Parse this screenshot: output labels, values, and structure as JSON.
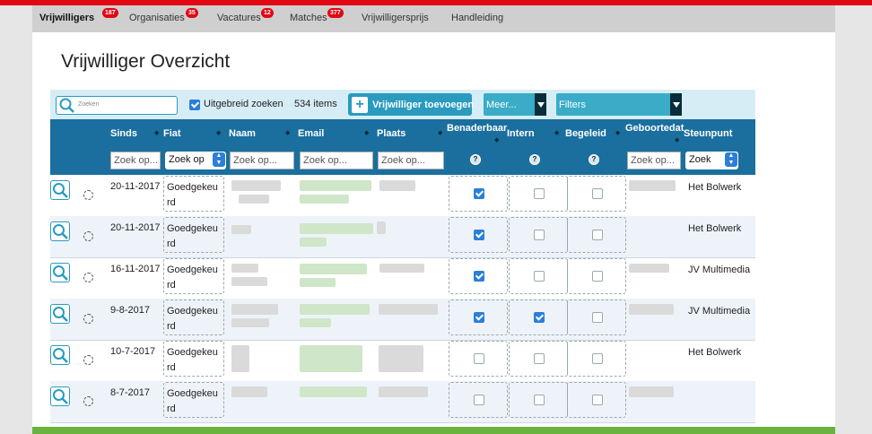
{
  "nav": {
    "items": [
      {
        "label": "Vrijwilligers",
        "badge": "187",
        "active": true
      },
      {
        "label": "Organisaties",
        "badge": "35"
      },
      {
        "label": "Vacatures",
        "badge": "12"
      },
      {
        "label": "Matches",
        "badge": "377"
      },
      {
        "label": "Vrijwilligersprijs"
      },
      {
        "label": "Handleiding"
      }
    ]
  },
  "page": {
    "title": "Vrijwilliger Overzicht"
  },
  "toolbar": {
    "search_placeholder": "Zoeken",
    "extended_search_label": "Uitgebreid zoeken",
    "extended_search_checked": true,
    "item_count": "534 items",
    "add_button_label": "Vrijwilliger toevoegen",
    "more_label": "Meer...",
    "filters_label": "Filters"
  },
  "table": {
    "columns": [
      "Sinds",
      "Fiat",
      "Naam",
      "Email",
      "Plaats",
      "Benaderbaar",
      "Intern",
      "Begeleid",
      "Geboortedat",
      "Steunpunt"
    ],
    "filter_placeholder": "Zoek op...",
    "select_label": "Zoek op",
    "steunpunt_select_label": "Zoek",
    "rows": [
      {
        "sinds": "20-11-2017",
        "fiat": "Goedgekeurd",
        "benaderbaar": true,
        "intern": false,
        "begeleid": false,
        "steunpunt": "Het Bolwerk"
      },
      {
        "sinds": "20-11-2017",
        "fiat": "Goedgekeurd",
        "benaderbaar": true,
        "intern": false,
        "begeleid": false,
        "steunpunt": "Het Bolwerk"
      },
      {
        "sinds": "16-11-2017",
        "fiat": "Goedgekeurd",
        "benaderbaar": true,
        "intern": false,
        "begeleid": false,
        "steunpunt": "JV Multimedia"
      },
      {
        "sinds": "9-8-2017",
        "fiat": "Goedgekeurd",
        "benaderbaar": true,
        "intern": true,
        "begeleid": false,
        "steunpunt": "JV Multimedia"
      },
      {
        "sinds": "10-7-2017",
        "fiat": "Goedgekeurd",
        "benaderbaar": false,
        "intern": false,
        "begeleid": false,
        "steunpunt": "Het Bolwerk"
      },
      {
        "sinds": "8-7-2017",
        "fiat": "Goedgekeurd",
        "benaderbaar": false,
        "intern": false,
        "begeleid": false,
        "steunpunt": ""
      }
    ]
  },
  "colors": {
    "accent_red": "#e30613",
    "accent_green": "#6ab33e",
    "header_blue": "#1a6f9e",
    "button_blue": "#2a9bbf"
  }
}
